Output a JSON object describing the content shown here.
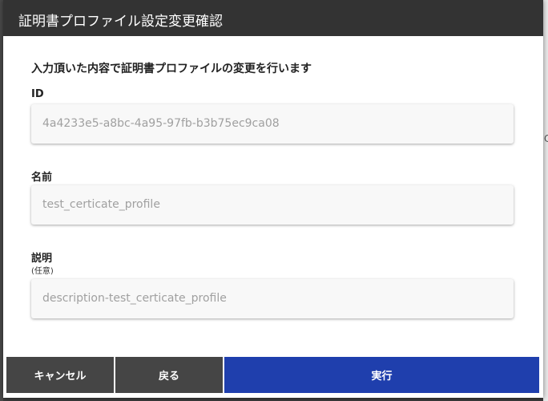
{
  "dialog": {
    "title": "証明書プロファイル設定変更確認",
    "intro": "入力頂いた内容で証明書プロファイルの変更を行います"
  },
  "fields": {
    "id": {
      "label": "ID",
      "value": "4a4233e5-a8bc-4a95-97fb-b3b75ec9ca08"
    },
    "name": {
      "label": "名前",
      "value": "test_certicate_profile"
    },
    "description": {
      "label": "説明",
      "sublabel": "(任意)",
      "value": "description-test_certicate_profile"
    }
  },
  "buttons": {
    "cancel": "キャンセル",
    "back": "戻る",
    "run": "実行"
  },
  "background": {
    "right_glyph": "C"
  },
  "colors": {
    "header": "#333333",
    "primary": "#1f3fad",
    "secondary": "#454545"
  }
}
